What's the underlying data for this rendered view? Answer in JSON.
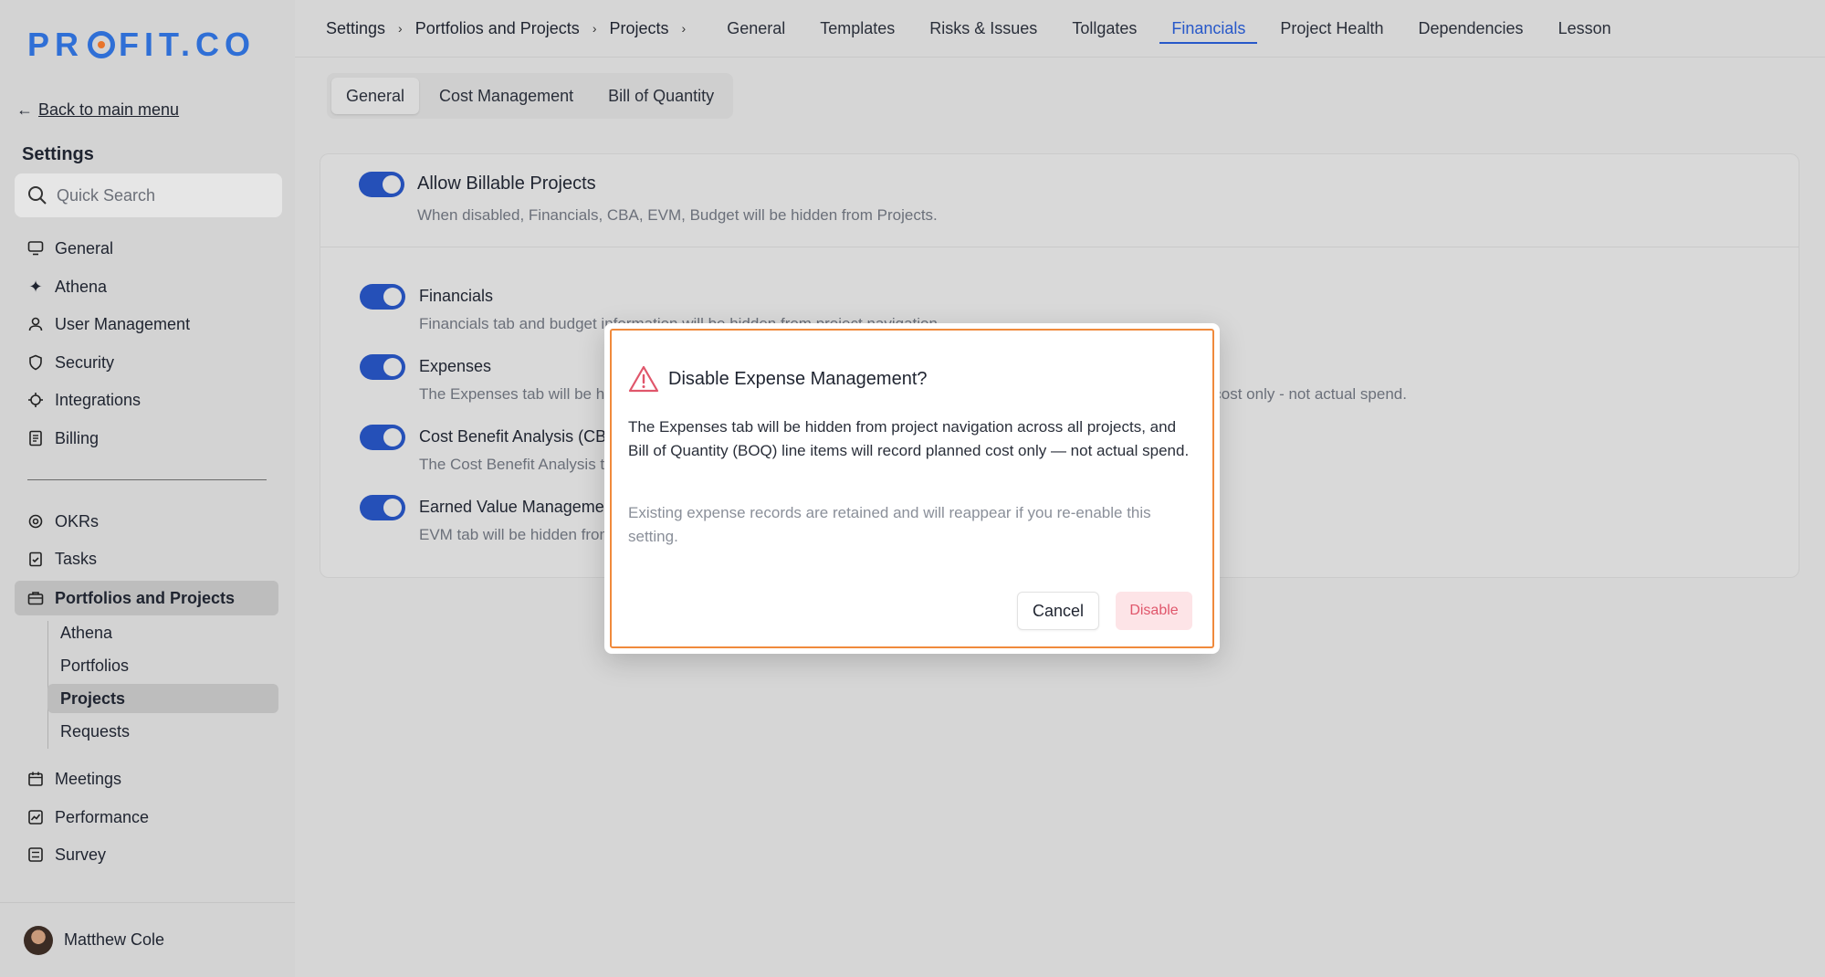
{
  "sidebar": {
    "logo": "PROFIT.CO",
    "back_label": "Back to main menu",
    "section_title": "Settings",
    "search_placeholder": "Quick Search",
    "items_top": [
      {
        "label": "General",
        "icon": "monitor-icon"
      },
      {
        "label": "Athena",
        "icon": "sparkle-icon"
      },
      {
        "label": "User Management",
        "icon": "user-icon"
      },
      {
        "label": "Security",
        "icon": "shield-icon"
      },
      {
        "label": "Integrations",
        "icon": "plug-icon"
      },
      {
        "label": "Billing",
        "icon": "receipt-icon"
      }
    ],
    "items_bottom": [
      {
        "label": "OKRs",
        "icon": "target-icon"
      },
      {
        "label": "Tasks",
        "icon": "clipboard-check-icon"
      },
      {
        "label": "Portfolios and Projects",
        "icon": "briefcase-icon"
      }
    ],
    "sub_items": [
      "Athena",
      "Portfolios",
      "Projects",
      "Requests"
    ],
    "items_after": [
      {
        "label": "Meetings",
        "icon": "calendar-icon"
      },
      {
        "label": "Performance",
        "icon": "chart-icon"
      },
      {
        "label": "Survey",
        "icon": "list-icon"
      }
    ],
    "user_name": "Matthew Cole"
  },
  "breadcrumb": [
    "Settings",
    "Portfolios and Projects",
    "Projects"
  ],
  "top_tabs": [
    "General",
    "Templates",
    "Risks & Issues",
    "Tollgates",
    "Financials",
    "Project Health",
    "Dependencies",
    "Lesson"
  ],
  "active_top_tab": "Financials",
  "sub_tabs": [
    "General",
    "Cost Management",
    "Bill of Quantity"
  ],
  "card": {
    "main_title": "Allow Billable Projects",
    "main_desc": "When disabled, Financials, CBA, EVM, Budget will be hidden from Projects.",
    "rows": [
      {
        "title": "Financials",
        "desc": "Financials tab and budget information will be hidden from project navigation."
      },
      {
        "title": "Expenses",
        "desc": "The Expenses tab will be hidden from project navigation across all projects, and BOQ line items will record planned cost only - not actual spend."
      },
      {
        "title": "Cost Benefit Analysis (CBA)",
        "desc": "The Cost Benefit Analysis tab will be hidden from project navigation."
      },
      {
        "title": "Earned Value Management (EVM)",
        "desc": "EVM tab will be hidden from project navigation."
      }
    ]
  },
  "dialog": {
    "title": "Disable Expense Management?",
    "body": "The Expenses tab will be hidden from project navigation across all projects, and Bill of Quantity (BOQ) line items will record planned cost only — not actual spend.",
    "note": "Existing expense records are retained and will reappear if you re-enable this setting.",
    "cancel_label": "Cancel",
    "disable_label": "Disable"
  },
  "colors": {
    "accent": "#2758c9",
    "toggle": "#2550b8",
    "danger": "#e0566b",
    "dialog_outline": "#f08a3c"
  }
}
